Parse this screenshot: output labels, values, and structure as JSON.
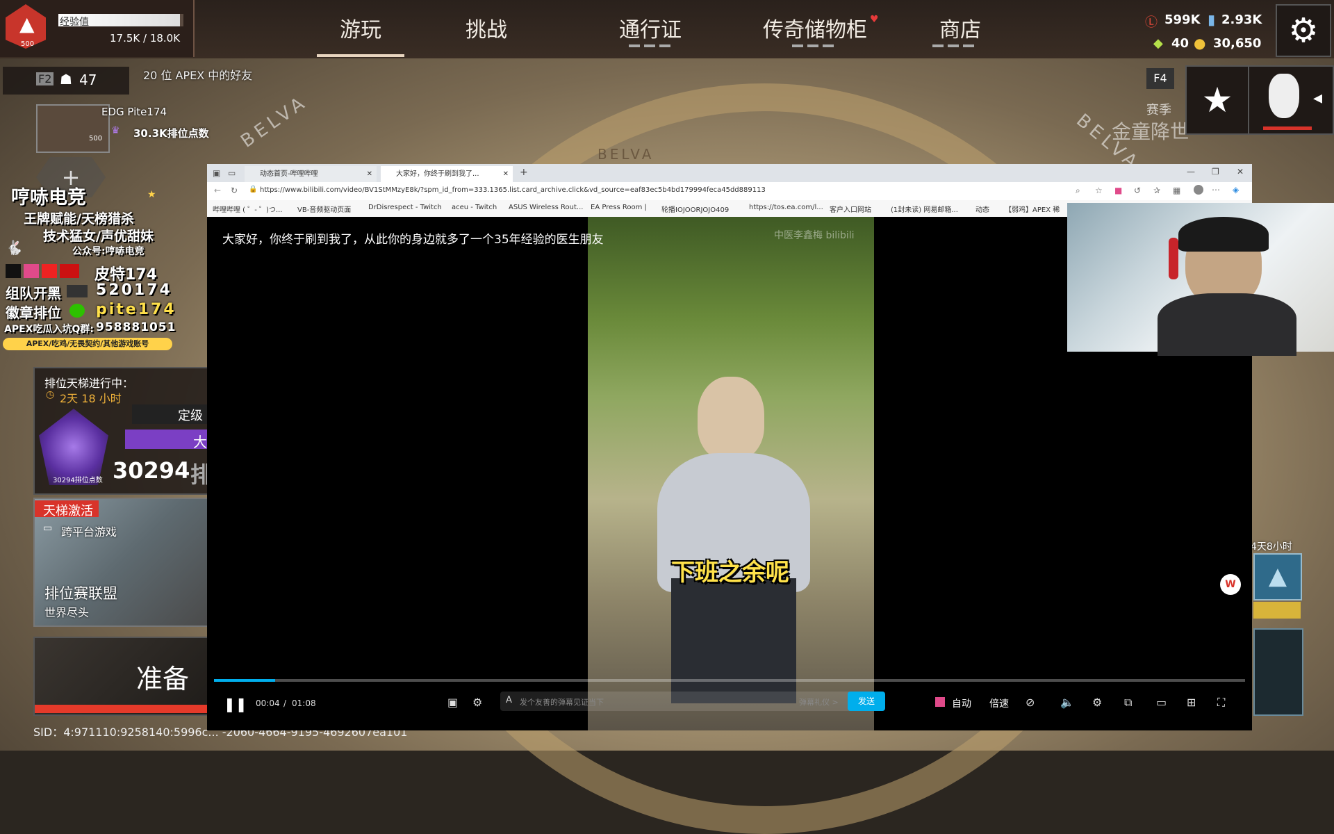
{
  "top_nav": {
    "xp_label": "经验值",
    "xp_value": "17.5K / 18.0K",
    "xp_progress": 0.97,
    "level_badge": "500",
    "tabs": [
      "游玩",
      "挑战",
      "通行证",
      "传奇储物柜",
      "商店"
    ],
    "active_tab": "游玩",
    "currency": {
      "legend_tokens": "599K",
      "crafting_metals": "2.93K",
      "apex_packs": "40",
      "apex_coins": "30,650"
    }
  },
  "left_panel": {
    "friends_key": "F2",
    "friends_count": "47",
    "friends_online": "20 位 APEX 中的好友",
    "player_name": "EDG Pite174",
    "player_level": "500",
    "rank_points": "30.3K排位点数",
    "stream_overlay": {
      "title": "哼哧电竞",
      "line1": "王牌赋能/天榜猎杀",
      "line2": "技术猛女/声优甜妹",
      "line3": "公众号:哼哧电竞",
      "row1_label": "皮特174",
      "row2_label": "组队开黑",
      "row2_value": "520174",
      "row3_label": "徽章排位",
      "row3_value": "pite174",
      "row4_label": "APEX吃瓜入坑Q群:",
      "row4_value": "958881051",
      "row5": "APEX/吃鸡/无畏契约/其他游戏账号"
    },
    "ranked": {
      "title": "排位天梯进行中：",
      "timer": "2天 18 小时",
      "tier_label": "定级",
      "tier_partial": "大",
      "points": "30294",
      "points_suffix": "排",
      "badge_caption": "30294排位点数"
    },
    "ladder": {
      "badge": "天梯激活",
      "crossplay": "跨平台游戏",
      "mode": "排位赛联盟",
      "map": "世界尽头"
    },
    "ready_button": "准备",
    "sid": "SID：4:971110:9258140:5996c... -2060-4664-9195-4692607ea101"
  },
  "right_panel": {
    "key_hint": "F4",
    "season_label": "赛季",
    "season_name": "金童降世",
    "event_timer": "4天8小时",
    "belva_text": "BELVA"
  },
  "browser": {
    "tabs": [
      {
        "title": "动态首页-哔哩哔哩",
        "active": false
      },
      {
        "title": "大家好，你终于刷到我了...",
        "active": true
      }
    ],
    "new_tab": "+",
    "url": "https://www.bilibili.com/video/BV1StMMzyE8k/?spm_id_from=333.1365.list.card_archive.click&vd_source=eaf83ec5b4bd179994feca45dd889113",
    "bookmarks": [
      "哔哩哔哩 ( ゜- ゜)つ...",
      "VB-音频驱动页面",
      "DrDisrespect - Twitch",
      "aceu - Twitch",
      "ASUS Wireless Rout...",
      "EA Press Room |",
      "轮播IOJOORJOJO409",
      "https://tos.ea.com/l...",
      "客户入口网站",
      "(1封未读) 网易邮箱...",
      "动态",
      "【弱鸡】APEX 稀"
    ]
  },
  "video": {
    "title_overlay": "大家好，你终于刷到我了，从此你的身边就多了一个35年经验的医生朋友",
    "watermark": "中医李鑫梅 bilibili",
    "subtitle": "下班之余呢",
    "time_current": "00:04",
    "time_total": "01:08",
    "progress": 0.059,
    "danmaku_placeholder": "发个友善的弹幕见证当下",
    "danmaku_etiquette": "弹幕礼仪 >",
    "send_button": "发送",
    "auto_label": "自动",
    "speed_label": "倍速"
  },
  "colors": {
    "accent_red": "#d8332a",
    "bili_blue": "#00aeec",
    "ranked_purple": "#7b3fc4",
    "gold": "#e7b73d"
  }
}
